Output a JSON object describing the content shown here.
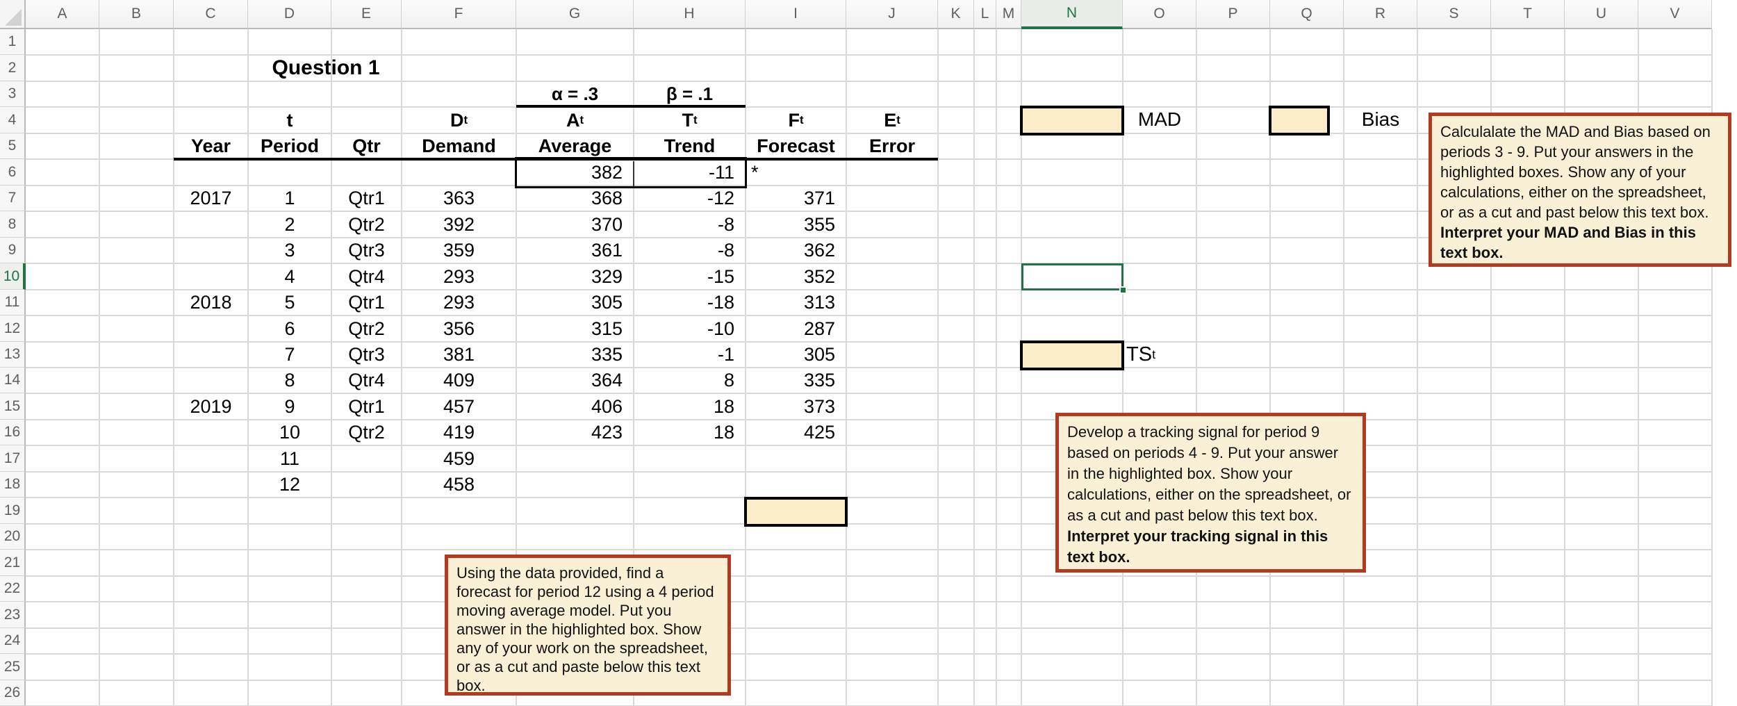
{
  "colors": {
    "accent_green": "#217346",
    "highlight_fill": "#fbedca",
    "note_fill": "#faf0d5",
    "note_border": "#b23a20",
    "grid_line": "#d9d9d9"
  },
  "sheet": {
    "column_letters": [
      "A",
      "B",
      "C",
      "D",
      "E",
      "F",
      "G",
      "H",
      "I",
      "J",
      "K",
      "L",
      "M",
      "N",
      "O",
      "P",
      "Q",
      "R",
      "S",
      "T",
      "U",
      "V"
    ],
    "row_numbers": [
      1,
      2,
      3,
      4,
      5,
      6,
      7,
      8,
      9,
      10,
      11,
      12,
      13,
      14,
      15,
      16,
      17,
      18,
      19,
      20,
      21,
      22,
      23,
      24,
      25,
      26
    ],
    "selected_column": "N",
    "selected_row": 10,
    "title": "Question 1",
    "alpha_label": "α = .3",
    "beta_label": "β = .1",
    "symbol_row": [
      {
        "col": "D",
        "base": "t",
        "sub": ""
      },
      {
        "col": "F",
        "base": "D",
        "sub": "t"
      },
      {
        "col": "G",
        "base": "A",
        "sub": "t"
      },
      {
        "col": "H",
        "base": "T",
        "sub": "t"
      },
      {
        "col": "I",
        "base": "F",
        "sub": "t"
      },
      {
        "col": "J",
        "base": "E",
        "sub": "t"
      }
    ],
    "header_row": [
      {
        "col": "C",
        "text": "Year"
      },
      {
        "col": "D",
        "text": "Period"
      },
      {
        "col": "E",
        "text": "Qtr"
      },
      {
        "col": "F",
        "text": "Demand"
      },
      {
        "col": "G",
        "text": "Average"
      },
      {
        "col": "H",
        "text": "Trend"
      },
      {
        "col": "I",
        "text": "Forecast"
      },
      {
        "col": "J",
        "text": "Error"
      }
    ],
    "init_row": {
      "average": "382",
      "trend": "-11",
      "note": "*"
    },
    "data_rows": [
      {
        "row": 7,
        "year": "2017",
        "period": "1",
        "qtr": "Qtr1",
        "demand": "363",
        "average": "368",
        "trend": "-12",
        "forecast": "371"
      },
      {
        "row": 8,
        "year": "",
        "period": "2",
        "qtr": "Qtr2",
        "demand": "392",
        "average": "370",
        "trend": "-8",
        "forecast": "355"
      },
      {
        "row": 9,
        "year": "",
        "period": "3",
        "qtr": "Qtr3",
        "demand": "359",
        "average": "361",
        "trend": "-8",
        "forecast": "362"
      },
      {
        "row": 10,
        "year": "",
        "period": "4",
        "qtr": "Qtr4",
        "demand": "293",
        "average": "329",
        "trend": "-15",
        "forecast": "352"
      },
      {
        "row": 11,
        "year": "2018",
        "period": "5",
        "qtr": "Qtr1",
        "demand": "293",
        "average": "305",
        "trend": "-18",
        "forecast": "313"
      },
      {
        "row": 12,
        "year": "",
        "period": "6",
        "qtr": "Qtr2",
        "demand": "356",
        "average": "315",
        "trend": "-10",
        "forecast": "287"
      },
      {
        "row": 13,
        "year": "",
        "period": "7",
        "qtr": "Qtr3",
        "demand": "381",
        "average": "335",
        "trend": "-1",
        "forecast": "305"
      },
      {
        "row": 14,
        "year": "",
        "period": "8",
        "qtr": "Qtr4",
        "demand": "409",
        "average": "364",
        "trend": "8",
        "forecast": "335"
      },
      {
        "row": 15,
        "year": "2019",
        "period": "9",
        "qtr": "Qtr1",
        "demand": "457",
        "average": "406",
        "trend": "18",
        "forecast": "373"
      },
      {
        "row": 16,
        "year": "",
        "period": "10",
        "qtr": "Qtr2",
        "demand": "419",
        "average": "423",
        "trend": "18",
        "forecast": "425"
      },
      {
        "row": 17,
        "year": "",
        "period": "11",
        "qtr": "",
        "demand": "459",
        "average": "",
        "trend": "",
        "forecast": ""
      },
      {
        "row": 18,
        "year": "",
        "period": "12",
        "qtr": "",
        "demand": "458",
        "average": "",
        "trend": "",
        "forecast": ""
      }
    ],
    "labels": {
      "mad": "MAD",
      "bias": "Bias",
      "ts_base": "TS",
      "ts_sub": "t"
    }
  },
  "text_boxes": [
    {
      "id": "mad-bias-note",
      "text": "Calculalate the MAD and Bias based on periods 3 - 9. Put your answers in the highlighted boxes.  Show any of your calculations, either on the spreadsheet, or as a cut and past below this text box. ",
      "bold_text": "Interpret your MAD and Bias in this text box."
    },
    {
      "id": "tracking-signal-note",
      "text": "Develop a tracking signal for period 9 based on periods 4 - 9.  Put your answer in the highlighted box. Show your calculations, either on the spreadsheet, or as a cut and past below this text box. ",
      "bold_text": "Interpret your tracking signal in this text box."
    },
    {
      "id": "moving-average-note",
      "text": "Using the data provided, find a forecast for period 12 using a 4 period moving average model. Put you answer in the highlighted box. Show any of your work on the spreadsheet, or as a cut and paste below this text box.",
      "bold_text": ""
    }
  ]
}
